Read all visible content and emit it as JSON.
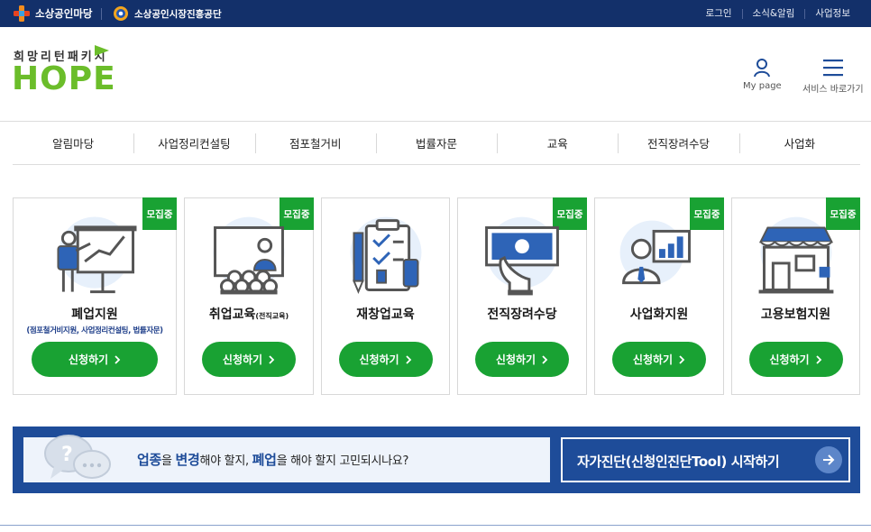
{
  "topbar": {
    "logo_primary": "소상공인마당",
    "logo_secondary": "소상공인시장진흥공단",
    "links": [
      "로그인",
      "소식&알림",
      "사업정보"
    ]
  },
  "header": {
    "brand_sub": "희망리턴패키지",
    "brand_name": "HOPE",
    "mypage_label": "My page",
    "menu_label": "서비스 바로가기"
  },
  "nav": [
    "알림마당",
    "사업정리컨설팅",
    "점포철거비",
    "법률자문",
    "교육",
    "전직장려수당",
    "사업화"
  ],
  "cards": [
    {
      "title": "폐업지원",
      "title_small": "",
      "sub": "(점포철거비지원, 사업정리컨설팅, 법률자문)",
      "badge": "모집중",
      "button": "신청하기"
    },
    {
      "title": "취업교육",
      "title_small": "(전직교육)",
      "sub": "",
      "badge": "모집중",
      "button": "신청하기"
    },
    {
      "title": "재창업교육",
      "title_small": "",
      "sub": "",
      "badge": "",
      "button": "신청하기"
    },
    {
      "title": "전직장려수당",
      "title_small": "",
      "sub": "",
      "badge": "모집중",
      "button": "신청하기"
    },
    {
      "title": "사업화지원",
      "title_small": "",
      "sub": "",
      "badge": "모집중",
      "button": "신청하기"
    },
    {
      "title": "고용보험지원",
      "title_small": "",
      "sub": "",
      "badge": "모집중",
      "button": "신청하기"
    }
  ],
  "banner": {
    "q_part1_bold": "업종",
    "q_part2": "을 ",
    "q_part3_bold": "변경",
    "q_part4": "해야 할지, ",
    "q_part5_bold": "폐업",
    "q_part6": "을 해야 할지 고민되시나요?",
    "cta": "자가진단(신청인진단Tool) 시작하기"
  },
  "colors": {
    "navy": "#13306a",
    "green": "#19a233",
    "brand_green": "#6bbd2a",
    "banner_blue": "#1e4c99"
  }
}
